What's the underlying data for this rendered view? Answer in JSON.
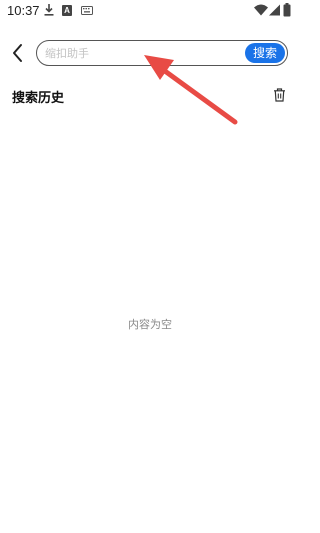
{
  "status_bar": {
    "time": "10:37",
    "icons": [
      "download-icon",
      "a-app-icon",
      "keyboard-icon",
      "wifi-icon",
      "signal-icon",
      "battery-icon"
    ]
  },
  "search": {
    "placeholder": "缩扣助手",
    "value": "",
    "button_label": "搜索",
    "button_color": "#1a73e8"
  },
  "history": {
    "title": "搜索历史",
    "items": []
  },
  "empty_state": {
    "text": "内容为空"
  },
  "annotation": {
    "color": "#e84b45"
  }
}
